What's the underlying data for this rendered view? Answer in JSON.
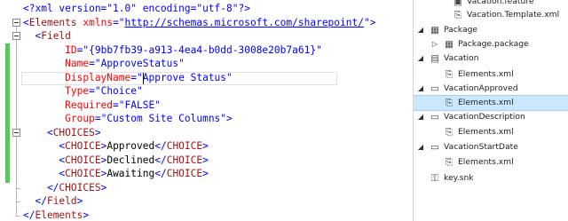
{
  "editor": {
    "lines": [
      [
        {
          "t": "xd",
          "v": "<?xml version=\"1.0\" encoding=\"utf-8\"?>"
        }
      ],
      [
        {
          "t": "xd",
          "v": "<"
        },
        {
          "t": "tg",
          "v": "Elements"
        },
        {
          "t": "at",
          "v": " xmlns"
        },
        {
          "t": "xd",
          "v": "=\""
        },
        {
          "t": "lk",
          "v": "http://schemas.microsoft.com/sharepoint/"
        },
        {
          "t": "xd",
          "v": "\">"
        }
      ],
      [
        {
          "t": "xd",
          "v": "  <"
        },
        {
          "t": "tg",
          "v": "Field"
        }
      ],
      [
        {
          "t": "at",
          "v": "       ID"
        },
        {
          "t": "xd",
          "v": "=\""
        },
        {
          "t": "vl",
          "v": "{9bb7fb39-a913-4ea4-b0dd-3008e20b7a61}"
        },
        {
          "t": "xd",
          "v": "\""
        }
      ],
      [
        {
          "t": "at",
          "v": "       Name"
        },
        {
          "t": "xd",
          "v": "=\""
        },
        {
          "t": "vl",
          "v": "ApproveStatus"
        },
        {
          "t": "xd",
          "v": "\""
        }
      ],
      [
        {
          "t": "at",
          "v": "       DisplayName"
        },
        {
          "t": "xd",
          "v": "=\""
        },
        {
          "t": "vl",
          "v": "Approve Status"
        },
        {
          "t": "xd",
          "v": "\""
        }
      ],
      [
        {
          "t": "at",
          "v": "       Type"
        },
        {
          "t": "xd",
          "v": "=\""
        },
        {
          "t": "vl",
          "v": "Choice"
        },
        {
          "t": "xd",
          "v": "\""
        }
      ],
      [
        {
          "t": "at",
          "v": "       Required"
        },
        {
          "t": "xd",
          "v": "=\""
        },
        {
          "t": "vl",
          "v": "FALSE"
        },
        {
          "t": "xd",
          "v": "\""
        }
      ],
      [
        {
          "t": "at",
          "v": "       Group"
        },
        {
          "t": "xd",
          "v": "=\""
        },
        {
          "t": "vl",
          "v": "Custom Site Columns"
        },
        {
          "t": "xd",
          "v": "\">"
        }
      ],
      [
        {
          "t": "xd",
          "v": "    <"
        },
        {
          "t": "tg",
          "v": "CHOICES"
        },
        {
          "t": "xd",
          "v": ">"
        }
      ],
      [
        {
          "t": "xd",
          "v": "      <"
        },
        {
          "t": "tg",
          "v": "CHOICE"
        },
        {
          "t": "xd",
          "v": ">"
        },
        {
          "t": "tx",
          "v": "Approved"
        },
        {
          "t": "xd",
          "v": "</"
        },
        {
          "t": "tg",
          "v": "CHOICE"
        },
        {
          "t": "xd",
          "v": ">"
        }
      ],
      [
        {
          "t": "xd",
          "v": "      <"
        },
        {
          "t": "tg",
          "v": "CHOICE"
        },
        {
          "t": "xd",
          "v": ">"
        },
        {
          "t": "tx",
          "v": "Declined"
        },
        {
          "t": "xd",
          "v": "</"
        },
        {
          "t": "tg",
          "v": "CHOICE"
        },
        {
          "t": "xd",
          "v": ">"
        }
      ],
      [
        {
          "t": "xd",
          "v": "      <"
        },
        {
          "t": "tg",
          "v": "CHOICE"
        },
        {
          "t": "xd",
          "v": ">"
        },
        {
          "t": "tx",
          "v": "Awaiting"
        },
        {
          "t": "xd",
          "v": "</"
        },
        {
          "t": "tg",
          "v": "CHOICE"
        },
        {
          "t": "xd",
          "v": ">"
        }
      ],
      [
        {
          "t": "xd",
          "v": "    </"
        },
        {
          "t": "tg",
          "v": "CHOICES"
        },
        {
          "t": "xd",
          "v": ">"
        }
      ],
      [
        {
          "t": "xd",
          "v": "  </"
        },
        {
          "t": "tg",
          "v": "Field"
        },
        {
          "t": "xd",
          "v": ">"
        }
      ],
      [
        {
          "t": "xd",
          "v": "</"
        },
        {
          "t": "tg",
          "v": "Elements"
        },
        {
          "t": "xd",
          "v": ">"
        }
      ]
    ]
  },
  "explorer": {
    "nodes": [
      {
        "label": "Vacation.feature",
        "icon": "feature-icon",
        "arrow": "",
        "indent": 3,
        "name": "node-vacation-feature"
      },
      {
        "label": "Vacation.Template.xml",
        "icon": "xml-file-icon",
        "arrow": "",
        "indent": 3,
        "name": "node-vacation-template"
      },
      {
        "label": "Package",
        "icon": "package-folder-icon",
        "arrow": "◢",
        "indent": 1,
        "name": "node-package"
      },
      {
        "label": "Package.package",
        "icon": "package-icon",
        "arrow": "▷",
        "indent": 2,
        "name": "node-package-package"
      },
      {
        "label": "Vacation",
        "icon": "list-icon",
        "arrow": "◢",
        "indent": 1,
        "name": "node-vacation"
      },
      {
        "label": "Elements.xml",
        "icon": "xml-file-icon",
        "arrow": "",
        "indent": 2,
        "name": "node-vacation-elements"
      },
      {
        "label": "VacationApproved",
        "icon": "field-icon",
        "arrow": "◢",
        "indent": 1,
        "name": "node-vacation-approved"
      },
      {
        "label": "Elements.xml",
        "icon": "xml-file-icon",
        "arrow": "",
        "indent": 2,
        "name": "node-approved-elements",
        "selected": true
      },
      {
        "label": "VacationDescription",
        "icon": "field-icon",
        "arrow": "◢",
        "indent": 1,
        "name": "node-vacation-description"
      },
      {
        "label": "Elements.xml",
        "icon": "xml-file-icon",
        "arrow": "",
        "indent": 2,
        "name": "node-description-elements"
      },
      {
        "label": "VacationStartDate",
        "icon": "field-icon",
        "arrow": "◢",
        "indent": 1,
        "name": "node-vacation-startdate"
      },
      {
        "label": "Elements.xml",
        "icon": "xml-file-icon",
        "arrow": "",
        "indent": 2,
        "name": "node-startdate-elements"
      },
      {
        "label": "key.snk",
        "icon": "key-file-icon",
        "arrow": "",
        "indent": 1,
        "name": "node-key-snk"
      }
    ],
    "colors": {
      "selection": "#cce8ff"
    }
  },
  "colors": {
    "xml_delimiter": "#0000ff",
    "tag": "#a31515",
    "attribute": "#ff0000",
    "change_bar": "#57c957"
  }
}
